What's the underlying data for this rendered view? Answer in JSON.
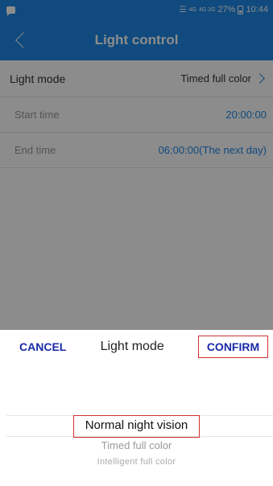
{
  "status_bar": {
    "network": "4G",
    "network_secondary": "4G 2G",
    "battery": "27%",
    "time": "10:44",
    "icons": [
      "chat-icon",
      "wifi-icon",
      "signal-icon",
      "battery-icon"
    ]
  },
  "header": {
    "title": "Light control",
    "back_icon": "chevron-left-icon"
  },
  "settings": {
    "light_mode": {
      "label": "Light mode",
      "value": "Timed full color"
    },
    "start_time": {
      "label": "Start time",
      "value": "20:00:00"
    },
    "end_time": {
      "label": "End time",
      "value": "06:00:00(The next day)"
    }
  },
  "picker": {
    "cancel_label": "CANCEL",
    "title": "Light mode",
    "confirm_label": "CONFIRM",
    "options": [
      "Normal night vision",
      "Timed full color",
      "Intelligent full color"
    ],
    "selected": "Normal night vision"
  },
  "colors": {
    "primary": "#1e88e5",
    "action_text": "#1a2aa8",
    "highlight_border": "#d32f2f"
  }
}
